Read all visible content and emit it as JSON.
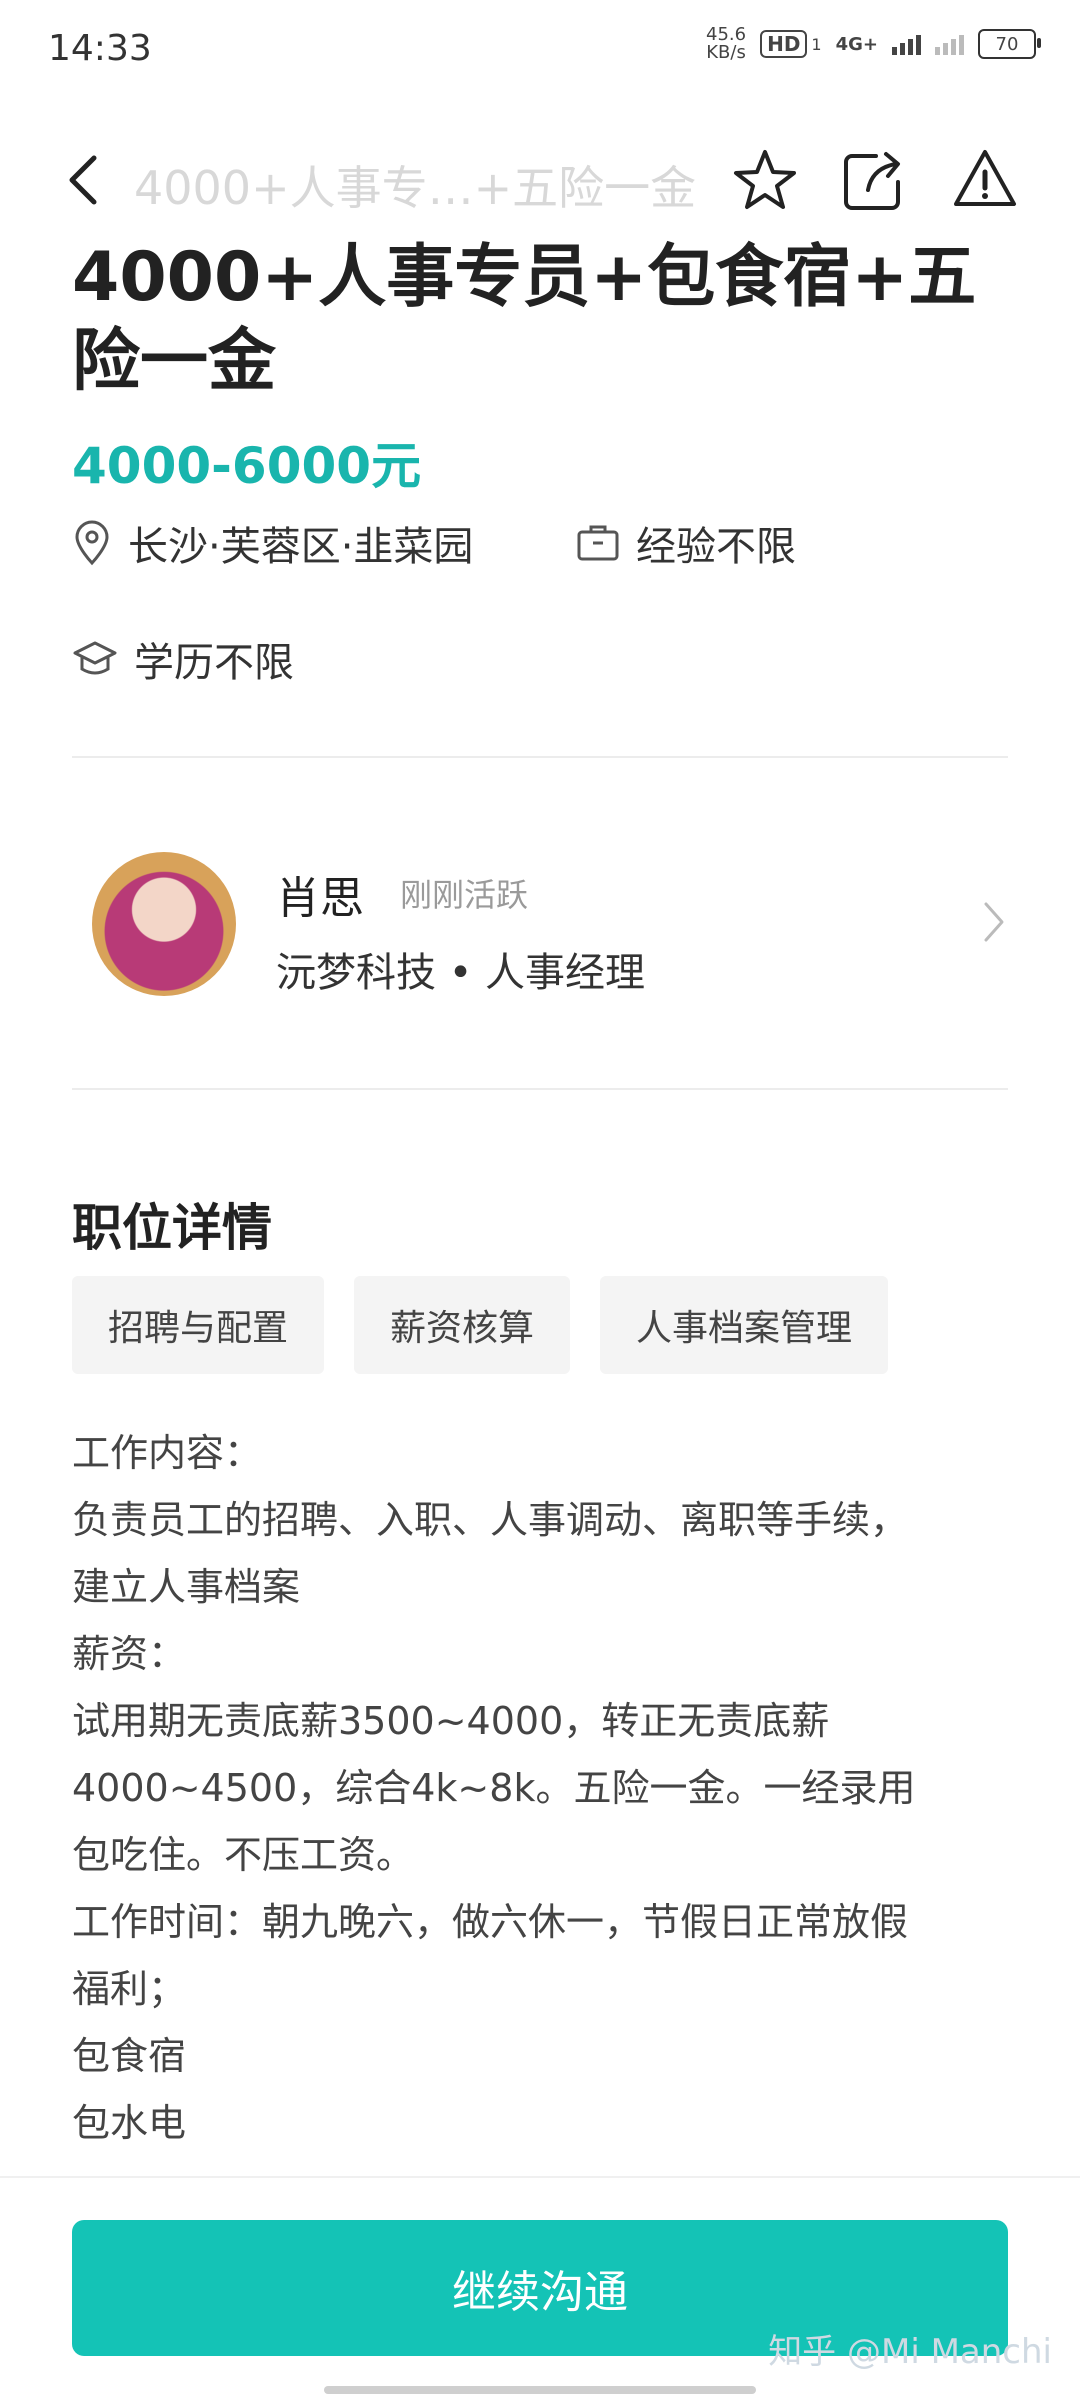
{
  "status_bar": {
    "time": "14:33",
    "net_speed_value": "45.6",
    "net_speed_unit": "KB/s",
    "hd_label": "HD",
    "hd_sub": "1",
    "network": "4G+",
    "battery": "70"
  },
  "nav": {
    "title": "4000+人事专…+五险一金"
  },
  "job": {
    "title": "4000+人事专员+包食宿+五险一金",
    "salary": "4000-6000元",
    "location": "长沙·芙蓉区·韭菜园",
    "experience": "经验不限",
    "education": "学历不限"
  },
  "recruiter": {
    "name": "肖思",
    "status": "刚刚活跃",
    "company_role": "沅梦科技 • 人事经理"
  },
  "details": {
    "section_title": "职位详情",
    "tags": [
      "招聘与配置",
      "薪资核算",
      "人事档案管理"
    ],
    "lines": [
      "工作内容：",
      "负责员工的招聘、入职、人事调动、离职等手续，",
      "建立人事档案",
      "薪资：",
      "试用期无责底薪3500~4000，转正无责底薪",
      "4000~4500，综合4k~8k。五险一金。一经录用",
      "包吃住。不压工资。",
      "工作时间：朝九晚六，做六休一，节假日正常放假",
      "福利；",
      "包食宿",
      "包水电"
    ]
  },
  "cta": {
    "label": "继续沟通"
  },
  "watermark": "知乎 @Mi Manchi",
  "colors": {
    "accent": "#19b5ad",
    "button": "#14c3b6"
  }
}
